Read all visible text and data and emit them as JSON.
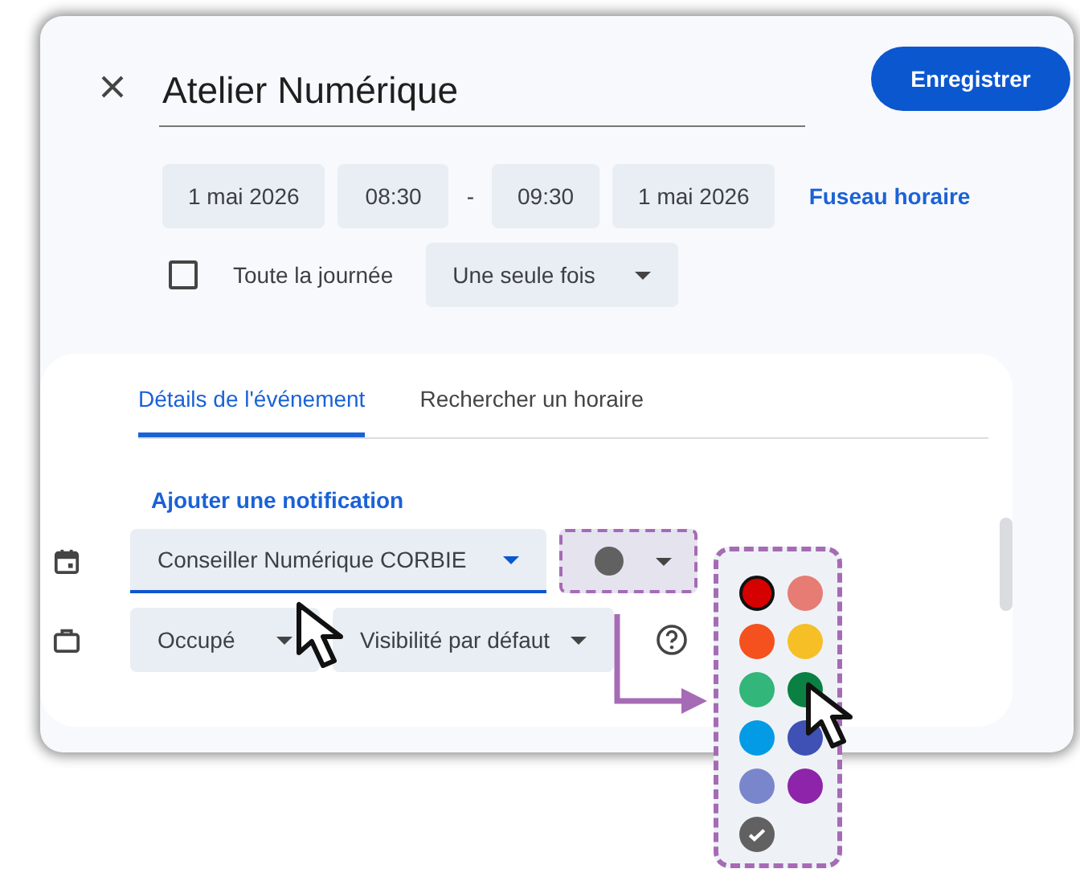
{
  "title": "Atelier Numérique",
  "save": "Enregistrer",
  "when": [
    {
      "kind": "chip",
      "text": "1 mai 2026"
    },
    {
      "kind": "chip",
      "text": "08:30"
    },
    {
      "kind": "sep",
      "text": "-"
    },
    {
      "kind": "chip",
      "text": "09:30"
    },
    {
      "kind": "chip",
      "text": "1 mai 2026"
    }
  ],
  "timezone_link": "Fuseau horaire",
  "all_day": {
    "label": "Toute la journée",
    "checked": false
  },
  "repeat": "Une seule fois",
  "tabs": [
    {
      "label": "Détails de l'événement",
      "selected": true
    },
    {
      "label": "Rechercher un horaire",
      "selected": false
    }
  ],
  "add_notification": "Ajouter une notification",
  "calendar": "Conseiller Numérique CORBIE",
  "event_color": {
    "color": "#616161"
  },
  "busy": "Occupé",
  "visibility": "Visibilité par défaut",
  "palette": [
    {
      "color": "#d50000",
      "selected": false,
      "focused": true
    },
    {
      "color": "#e67c73",
      "selected": false,
      "focused": false
    },
    {
      "color": "#f4511e",
      "selected": false,
      "focused": false
    },
    {
      "color": "#f6bf26",
      "selected": false,
      "focused": false
    },
    {
      "color": "#33b679",
      "selected": false,
      "focused": false
    },
    {
      "color": "#0b8043",
      "selected": false,
      "focused": false
    },
    {
      "color": "#039be5",
      "selected": false,
      "focused": false
    },
    {
      "color": "#3f51b5",
      "selected": false,
      "focused": false
    },
    {
      "color": "#7986cb",
      "selected": false,
      "focused": false
    },
    {
      "color": "#8e24aa",
      "selected": false,
      "focused": false
    },
    {
      "color": "#616161",
      "selected": true,
      "focused": false
    }
  ]
}
